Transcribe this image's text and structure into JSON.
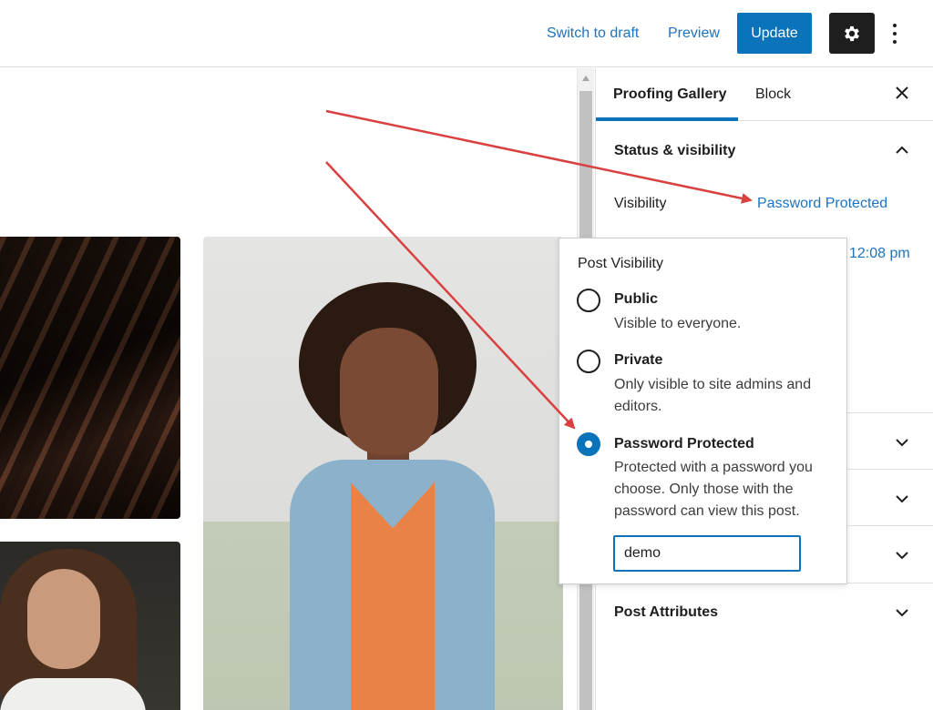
{
  "topbar": {
    "switch_to_draft": "Switch to draft",
    "preview": "Preview",
    "update": "Update",
    "settings_icon": "gear-icon",
    "more_icon": "vertical-ellipsis-icon"
  },
  "sidebar": {
    "tabs": [
      {
        "label": "Proofing Gallery",
        "active": true
      },
      {
        "label": "Block",
        "active": false
      }
    ],
    "close_icon": "close-icon",
    "status_visibility": {
      "title": "Status & visibility",
      "visibility_label": "Visibility",
      "visibility_value": "Password Protected",
      "publish_time": "12:08 pm"
    },
    "post_attributes": "Post Attributes"
  },
  "popover": {
    "title": "Post Visibility",
    "options": [
      {
        "label": "Public",
        "description": "Visible to everyone.",
        "selected": false
      },
      {
        "label": "Private",
        "description": "Only visible to site admins and editors.",
        "selected": false
      },
      {
        "label": "Password Protected",
        "description": "Protected with a password you choose. Only those with the password can view this post.",
        "selected": true
      }
    ],
    "password_value": "demo"
  },
  "colors": {
    "accent": "#0a73ba",
    "link": "#1e73be",
    "annotation_arrow": "#d94040"
  }
}
